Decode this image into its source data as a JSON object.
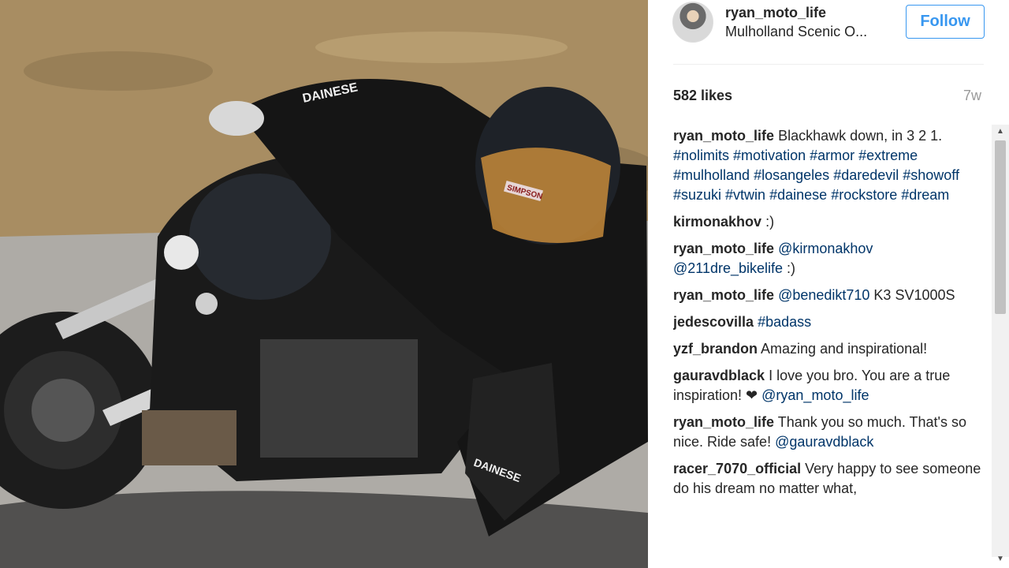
{
  "post": {
    "photo_icon": "motorcycle-rider-photo",
    "author": "ryan_moto_life",
    "location": "Mulholland Scenic O...",
    "follow_label": "Follow",
    "likes": "582 likes",
    "time_ago": "7w"
  },
  "comments": [
    {
      "user": "ryan_moto_life",
      "parts": [
        {
          "t": "Blackhawk down, in 3 2 1. "
        },
        {
          "t": "#nolimits",
          "tag": true
        },
        {
          "t": " "
        },
        {
          "t": "#motivation",
          "tag": true
        },
        {
          "t": " "
        },
        {
          "t": "#armor",
          "tag": true
        },
        {
          "t": " "
        },
        {
          "t": "#extreme",
          "tag": true
        },
        {
          "t": " "
        },
        {
          "t": "#mulholland",
          "tag": true
        },
        {
          "t": " "
        },
        {
          "t": "#losangeles",
          "tag": true
        },
        {
          "t": " "
        },
        {
          "t": "#daredevil",
          "tag": true
        },
        {
          "t": " "
        },
        {
          "t": "#showoff",
          "tag": true
        },
        {
          "t": " "
        },
        {
          "t": "#suzuki",
          "tag": true
        },
        {
          "t": " "
        },
        {
          "t": "#vtwin",
          "tag": true
        },
        {
          "t": " "
        },
        {
          "t": "#dainese",
          "tag": true
        },
        {
          "t": " "
        },
        {
          "t": "#rockstore",
          "tag": true
        },
        {
          "t": " "
        },
        {
          "t": "#dream",
          "tag": true
        }
      ]
    },
    {
      "user": "kirmonakhov",
      "parts": [
        {
          "t": ":)"
        }
      ]
    },
    {
      "user": "ryan_moto_life",
      "parts": [
        {
          "t": "@kirmonakhov",
          "tag": true
        },
        {
          "t": " "
        },
        {
          "t": "@211dre_bikelife",
          "tag": true
        },
        {
          "t": " :)"
        }
      ]
    },
    {
      "user": "ryan_moto_life",
      "parts": [
        {
          "t": "@benedikt710",
          "tag": true
        },
        {
          "t": " K3 SV1000S"
        }
      ]
    },
    {
      "user": "jedescovilla",
      "parts": [
        {
          "t": "#badass",
          "tag": true
        }
      ]
    },
    {
      "user": "yzf_brandon",
      "parts": [
        {
          "t": "Amazing and inspirational!"
        }
      ]
    },
    {
      "user": "gauravdblack",
      "parts": [
        {
          "t": "I love you bro. You are a true inspiration! ❤ "
        },
        {
          "t": "@ryan_moto_life",
          "tag": true
        }
      ]
    },
    {
      "user": "ryan_moto_life",
      "parts": [
        {
          "t": "Thank you so much. That's so nice. Ride safe! "
        },
        {
          "t": "@gauravdblack",
          "tag": true
        }
      ]
    },
    {
      "user": "racer_7070_official",
      "parts": [
        {
          "t": "Very happy to see someone do his dream no matter what,"
        }
      ]
    }
  ],
  "colors": {
    "accent": "#3897f0",
    "hashtag": "#003569",
    "muted": "#999999"
  }
}
